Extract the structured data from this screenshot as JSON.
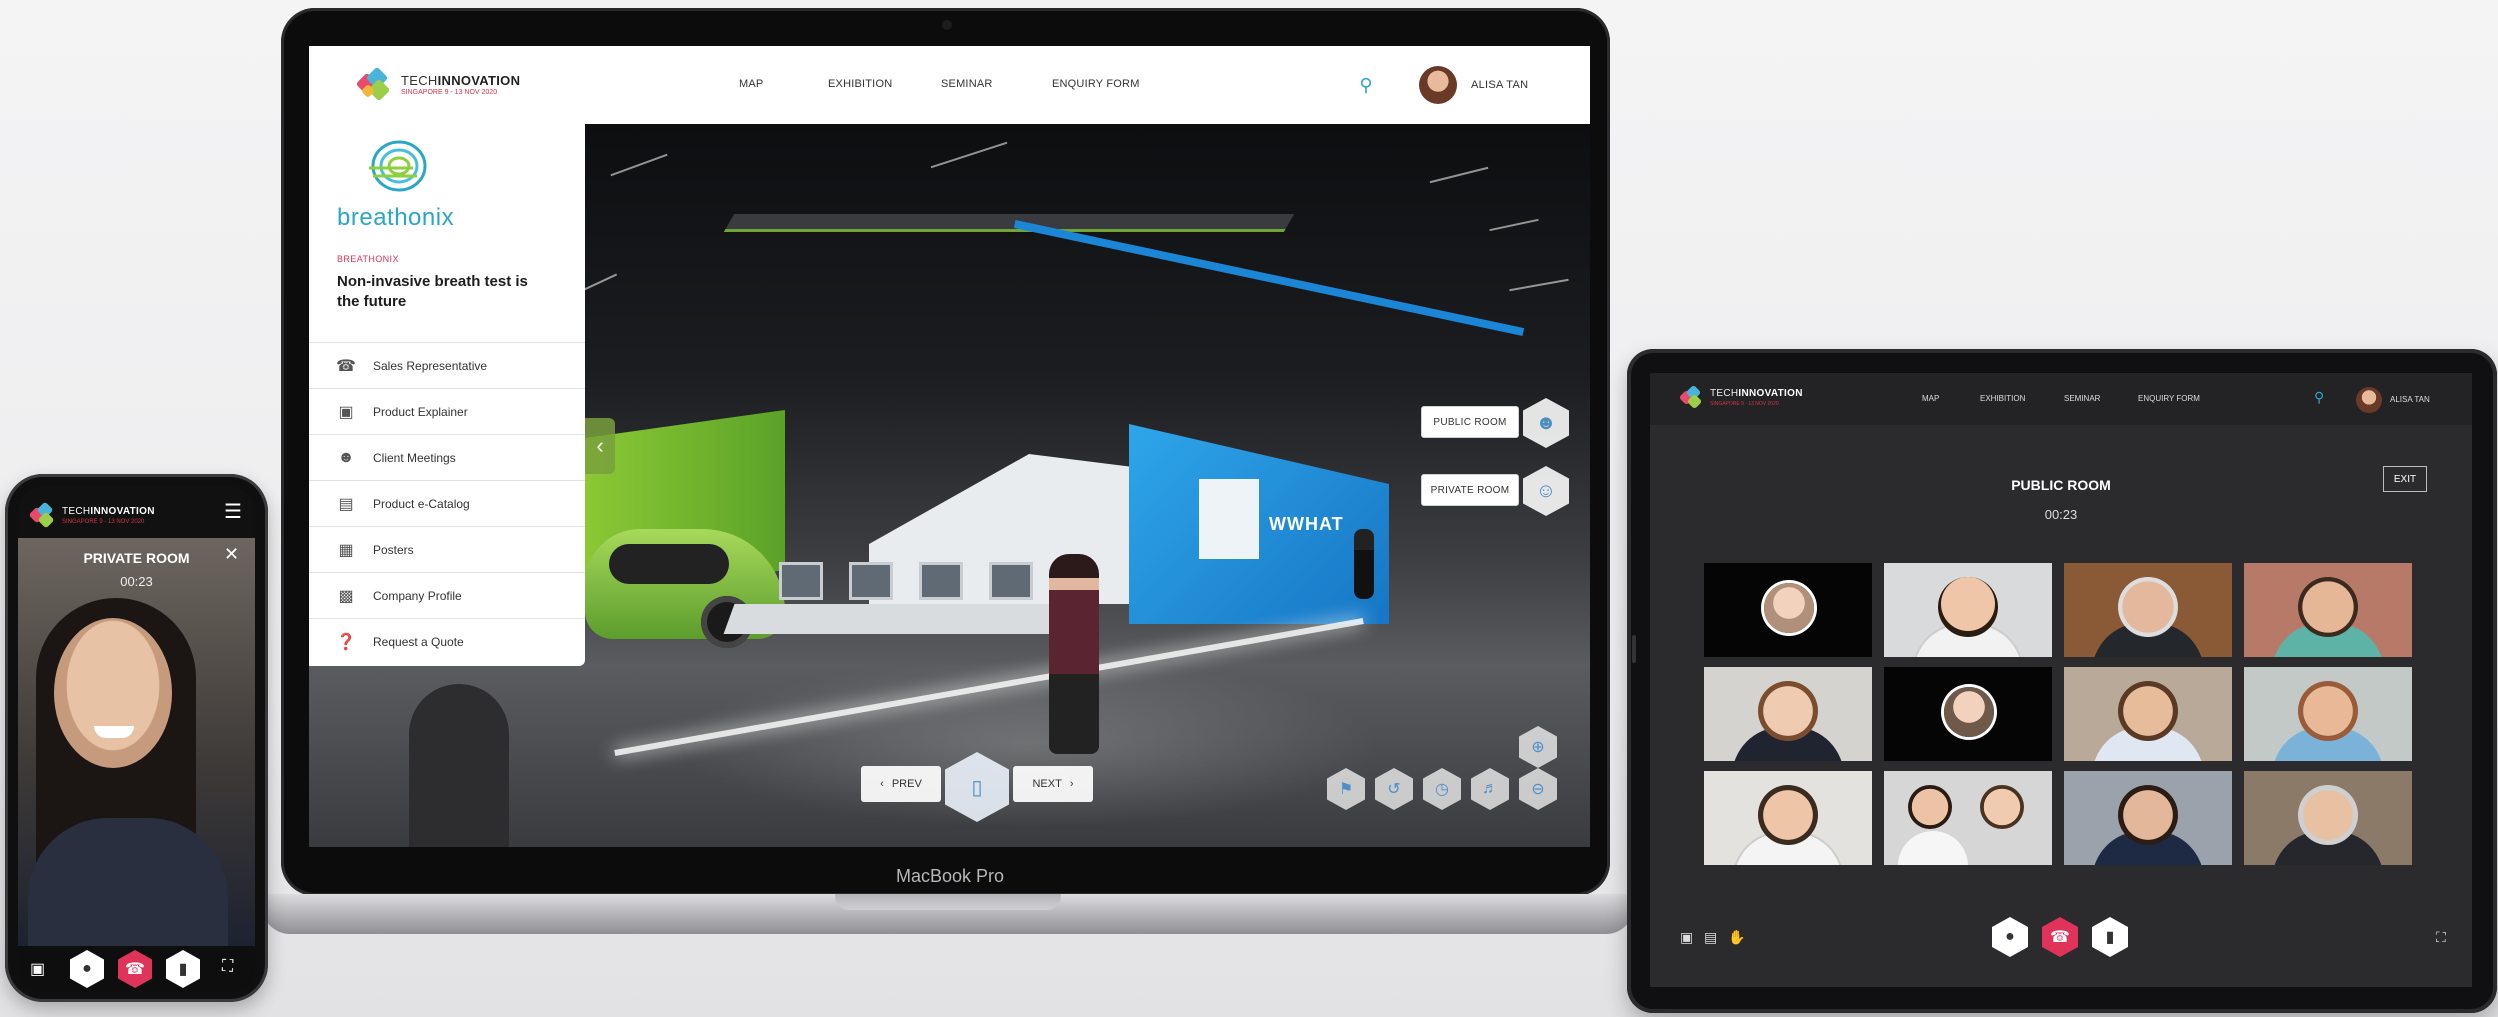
{
  "laptop": {
    "label": "MacBook Pro",
    "header": {
      "logo_title_light": "TECH",
      "logo_title_bold": "INNOVATION",
      "logo_subtitle": "SINGAPORE 9 - 13 NOV 2020",
      "nav": [
        "MAP",
        "EXHIBITION",
        "SEMINAR",
        "ENQUIRY FORM"
      ],
      "user_name": "ALISA TAN"
    },
    "panel": {
      "brand": "breathonix",
      "tag": "BREATHONIX",
      "headline": "Non-invasive breath test is the future",
      "items": [
        {
          "label": "Sales Representative",
          "icon": "headset-icon"
        },
        {
          "label": "Product Explainer",
          "icon": "presentation-icon"
        },
        {
          "label": "Client Meetings",
          "icon": "meeting-icon"
        },
        {
          "label": "Product e-Catalog",
          "icon": "catalog-icon"
        },
        {
          "label": "Posters",
          "icon": "poster-icon"
        },
        {
          "label": "Company Profile",
          "icon": "building-icon"
        },
        {
          "label": "Request a Quote",
          "icon": "quote-icon"
        }
      ]
    },
    "rooms": {
      "public": "PUBLIC ROOM",
      "private": "PRIVATE ROOM"
    },
    "pager": {
      "prev": "PREV",
      "next": "NEXT"
    },
    "booth_sign": "WWHAT"
  },
  "phone": {
    "room_title": "PRIVATE ROOM",
    "timer": "00:23"
  },
  "tablet": {
    "header": {
      "logo_title_light": "TECH",
      "logo_title_bold": "INNOVATION",
      "logo_subtitle": "SINGAPORE 9 - 13 NOV 2020",
      "nav": [
        "MAP",
        "EXHIBITION",
        "SEMINAR",
        "ENQUIRY FORM"
      ],
      "user_name": "ALISA TAN"
    },
    "room_title": "PUBLIC ROOM",
    "timer": "00:23",
    "exit_label": "EXIT"
  },
  "colors": {
    "accent_red": "#e0335a",
    "accent_blue": "#2aa6c8",
    "booth_blue": "#1e8ad8",
    "booth_green": "#7dbd30"
  }
}
